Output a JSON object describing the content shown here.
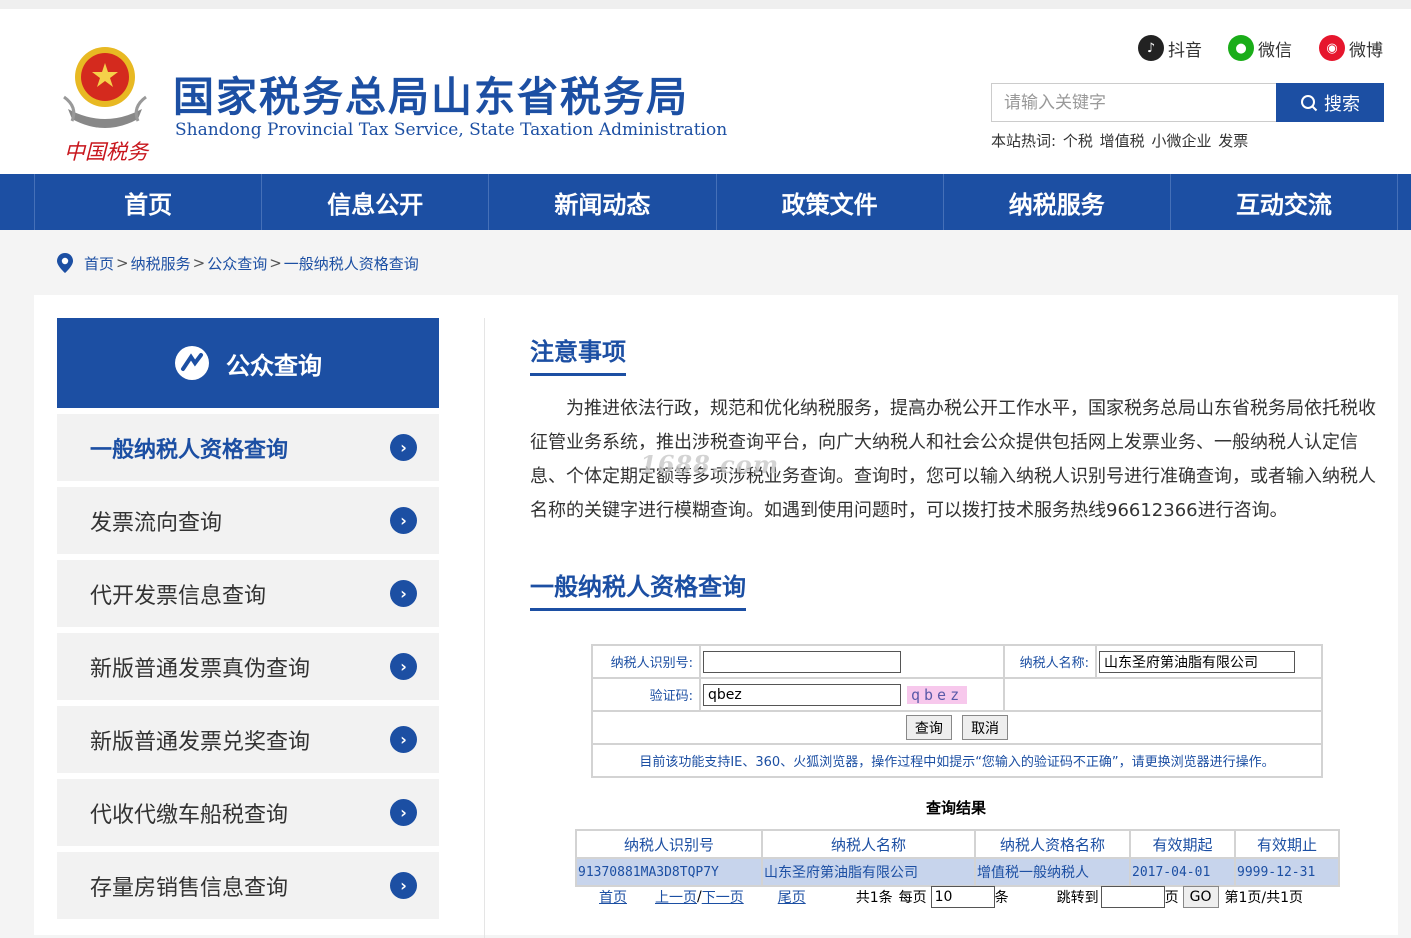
{
  "header": {
    "title": "国家税务总局山东省税务局",
    "subtitle": "Shandong Provincial Tax Service, State Taxation Administration",
    "emblem_text": "中国税务",
    "social": [
      {
        "label": "抖音",
        "icon": "douyin-icon",
        "color": "#222222"
      },
      {
        "label": "微信",
        "icon": "wechat-icon",
        "color": "#1aad19"
      },
      {
        "label": "微博",
        "icon": "weibo-icon",
        "color": "#e6162d"
      }
    ],
    "search": {
      "placeholder": "请输入关键字",
      "button_label": "搜索"
    },
    "hot": {
      "label": "本站热词:",
      "words": [
        "个税",
        "增值税",
        "小微企业",
        "发票"
      ]
    }
  },
  "nav": [
    "首页",
    "信息公开",
    "新闻动态",
    "政策文件",
    "纳税服务",
    "互动交流"
  ],
  "breadcrumb": [
    "首页",
    "纳税服务",
    "公众查询",
    "一般纳税人资格查询"
  ],
  "sidebar": {
    "title": "公众查询",
    "items": [
      "一般纳税人资格查询",
      "发票流向查询",
      "代开发票信息查询",
      "新版普通发票真伪查询",
      "新版普通发票兑奖查询",
      "代收代缴车船税查询",
      "存量房销售信息查询"
    ]
  },
  "notice": {
    "title": "注意事项",
    "text": "为推进依法行政，规范和优化纳税服务，提高办税公开工作水平，国家税务总局山东省税务局依托税收征管业务系统，推出涉税查询平台，向广大纳税人和社会公众提供包括网上发票业务、一般纳税人认定信息、个体定期定额等多项涉税业务查询。查询时，您可以输入纳税人识别号进行准确查询，或者输入纳税人名称的关键字进行模糊查询。如遇到使用问题时，可以拨打技术服务热线96612366进行咨询。"
  },
  "watermark": "1688.com",
  "query": {
    "title": "一般纳税人资格查询",
    "taxpayer_id_label": "纳税人识别号:",
    "taxpayer_id_value": "",
    "taxpayer_name_label": "纳税人名称:",
    "taxpayer_name_value": "山东圣府第油脂有限公司",
    "captcha_label": "验证码:",
    "captcha_value": "qbez",
    "captcha_image_text": "qbez",
    "query_button": "查询",
    "cancel_button": "取消",
    "tip": "目前该功能支持IE、360、火狐浏览器，操作过程中如提示“您输入的验证码不正确”，请更换浏览器进行操作。"
  },
  "results": {
    "title": "查询结果",
    "columns": [
      "纳税人识别号",
      "纳税人名称",
      "纳税人资格名称",
      "有效期起",
      "有效期止"
    ],
    "rows": [
      [
        "91370881MA3D8TQP7Y",
        "山东圣府第油脂有限公司",
        "增值税一般纳税人",
        "2017-04-01",
        "9999-12-31"
      ]
    ]
  },
  "pager": {
    "first": "首页",
    "prev": "上一页",
    "slash": "/",
    "next": "下一页",
    "last": "尾页",
    "total": "共1条",
    "per_page_label": "每页",
    "per_page_value": "10",
    "per_page_unit": "条",
    "jump_label": "跳转到",
    "jump_value": "",
    "page_unit": "页",
    "go_label": "GO",
    "status": "第1页/共1页"
  },
  "colors": {
    "brand": "#1c4fa3",
    "row_highlight": "#c7d4ec",
    "captcha_bg": "#f7c8ec"
  }
}
